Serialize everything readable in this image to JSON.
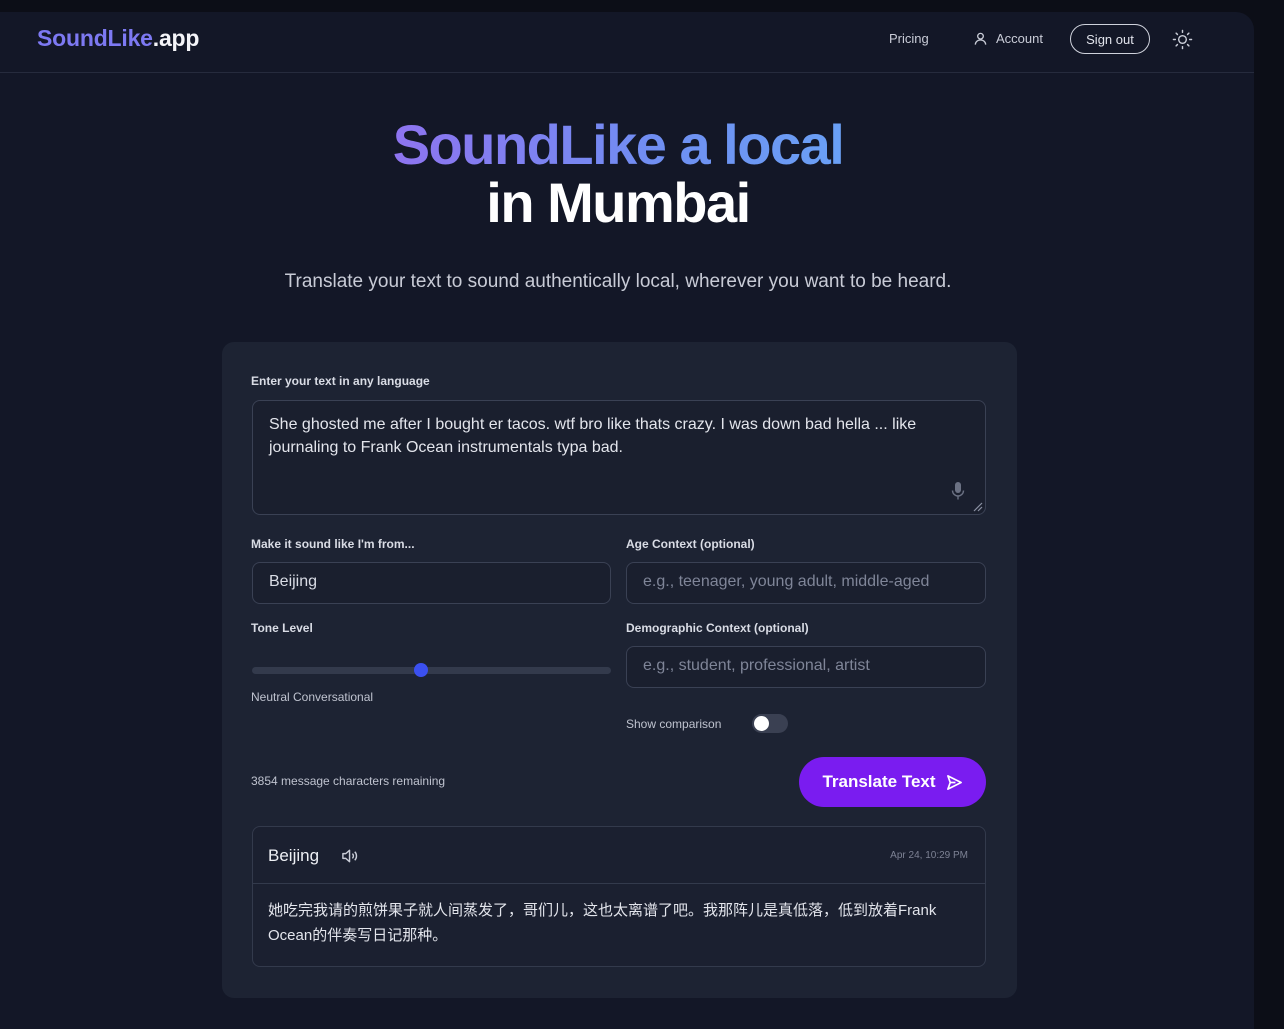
{
  "nav": {
    "logo_brand": "SoundLike",
    "logo_tld": ".app",
    "pricing": "Pricing",
    "account": "Account",
    "sign_out": "Sign out"
  },
  "hero": {
    "title_line1": "SoundLike a local",
    "title_line2": "in Mumbai",
    "subtitle": "Translate your text to sound authentically local, wherever you want to be heard."
  },
  "form": {
    "text_label": "Enter your text in any language",
    "text_value": "She ghosted me after I bought er tacos. wtf bro like thats crazy. I was down bad  hella ... like journaling to Frank Ocean instrumentals typa bad.",
    "location_label": "Make it sound like I'm from...",
    "location_value": "Beijing",
    "age_label": "Age Context (optional)",
    "age_placeholder": "e.g., teenager, young adult, middle-aged",
    "tone_label": "Tone Level",
    "tone_value_text": "Neutral Conversational",
    "tone_level_fraction": 0.47,
    "demographic_label": "Demographic Context (optional)",
    "demographic_placeholder": "e.g., student, professional, artist",
    "comparison_label": "Show comparison",
    "comparison_on": false,
    "remaining": "3854 message characters remaining",
    "translate_label": "Translate Text"
  },
  "result": {
    "city": "Beijing",
    "timestamp": "Apr 24, 10:29 PM",
    "text": "她吃完我请的煎饼果子就人间蒸发了，哥们儿，这也太离谱了吧。我那阵儿是真低落，低到放着Frank Ocean的伴奏写日记那种。"
  },
  "colors": {
    "accent": "#7a1cf0",
    "brand": "#7d79f2",
    "slider": "#3b50f0",
    "background": "#131727",
    "card": "#1d2333"
  }
}
